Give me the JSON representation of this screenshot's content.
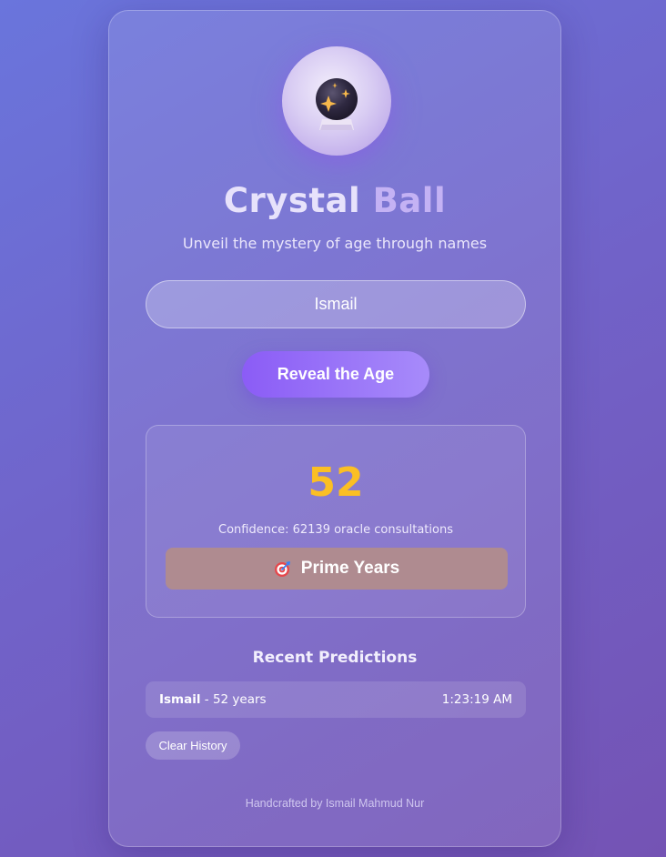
{
  "app": {
    "title_part1": "Crystal",
    "title_part2": "Ball",
    "subtitle": "Unveil the mystery of age through names",
    "logo_icon": "crystal-ball-icon"
  },
  "form": {
    "name_value": "Ismail",
    "reveal_label": "Reveal the Age"
  },
  "result": {
    "age": "52",
    "confidence_text": "Confidence: 62139 oracle consultations",
    "category_icon": "target-icon",
    "category_label": "Prime Years"
  },
  "history": {
    "title": "Recent Predictions",
    "items": [
      {
        "name": "Ismail",
        "detail": " - 52 years",
        "time": "1:23:19 AM"
      }
    ],
    "clear_label": "Clear History"
  },
  "footer": {
    "text": "Handcrafted by Ismail Mahmud Nur"
  },
  "colors": {
    "accent": "#8b5cf6",
    "age": "#fbbf24",
    "category_bg": "#af8b90"
  }
}
